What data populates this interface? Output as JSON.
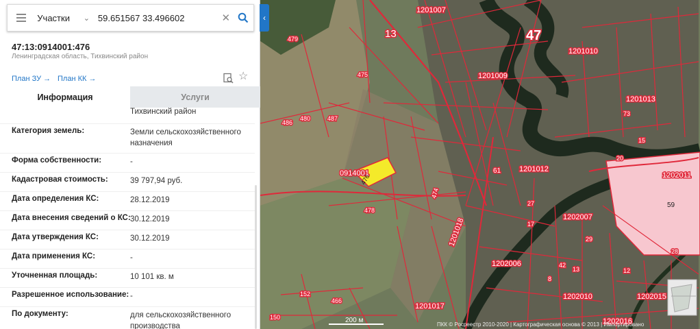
{
  "search": {
    "layer": "Участки",
    "query": "59.651567 33.496602"
  },
  "parcel": {
    "cadastral_number": "47:13:0914001:476",
    "region": "Ленинградская область, Тихвинский район"
  },
  "links": {
    "plan_zu": "План ЗУ →",
    "plan_kk": "План КК →"
  },
  "tabs": {
    "info": "Информация",
    "services": "Услуги"
  },
  "info": {
    "region_continuation": "Тихвинский район",
    "rows": [
      {
        "label": "Категория земель:",
        "value": "Земли сельскохозяйственного назначения"
      },
      {
        "label": "Форма собственности:",
        "value": "-"
      },
      {
        "label": "Кадастровая стоимость:",
        "value": "39 797,94 руб."
      },
      {
        "label": "Дата определения КС:",
        "value": "28.12.2019"
      },
      {
        "label": "Дата внесения сведений о КС:",
        "value": "30.12.2019"
      },
      {
        "label": "Дата утверждения КС:",
        "value": "30.12.2019"
      },
      {
        "label": "Дата применения КС:",
        "value": "-"
      },
      {
        "label": "Уточненная площадь:",
        "value": "10 101 кв. м"
      },
      {
        "label": "Разрешенное использование:",
        "value": "-"
      },
      {
        "label": "По документу:",
        "value": "для сельскохозяйственного производства"
      }
    ]
  },
  "map": {
    "labels": {
      "road_13": "13",
      "road_47": "47",
      "q_1201007": "1201007",
      "q_1201010": "1201010",
      "q_1201009": "1201009",
      "q_1201013": "1201013",
      "q_1201012": "1201012",
      "q_1202011": "1202011",
      "q_1202007": "1202007",
      "q_1202006": "1202006",
      "q_1202010": "1202010",
      "q_1202015": "1202015",
      "q_1202016": "1202016",
      "q_1201017": "1201017",
      "q_1201018": "1201018",
      "sel_block": "0914001",
      "n479": "479",
      "n475": "475",
      "n487": "487",
      "n480": "480",
      "n486": "486",
      "n474": "474",
      "n478": "478",
      "n61": "61",
      "n59": "59",
      "n73": "73",
      "n15": "15",
      "n20": "20",
      "n28": "28",
      "n42": "42",
      "n152": "152",
      "n150": "150",
      "n466": "466",
      "n17": "17",
      "n27": "27",
      "n29": "29",
      "n13": "13",
      "n12": "12",
      "n8": "8",
      "sel_476": "476"
    },
    "scale": "200 м",
    "attribution": "ПКК © Росреестр 2010-2020 | Картографическая основа © 2013 | Импортировано",
    "colors": {
      "boundary": "#e0283a",
      "selected_parcel": "#f4ea2a",
      "quarter_fill": "#f7c7cf",
      "accent": "#2176c7"
    }
  }
}
